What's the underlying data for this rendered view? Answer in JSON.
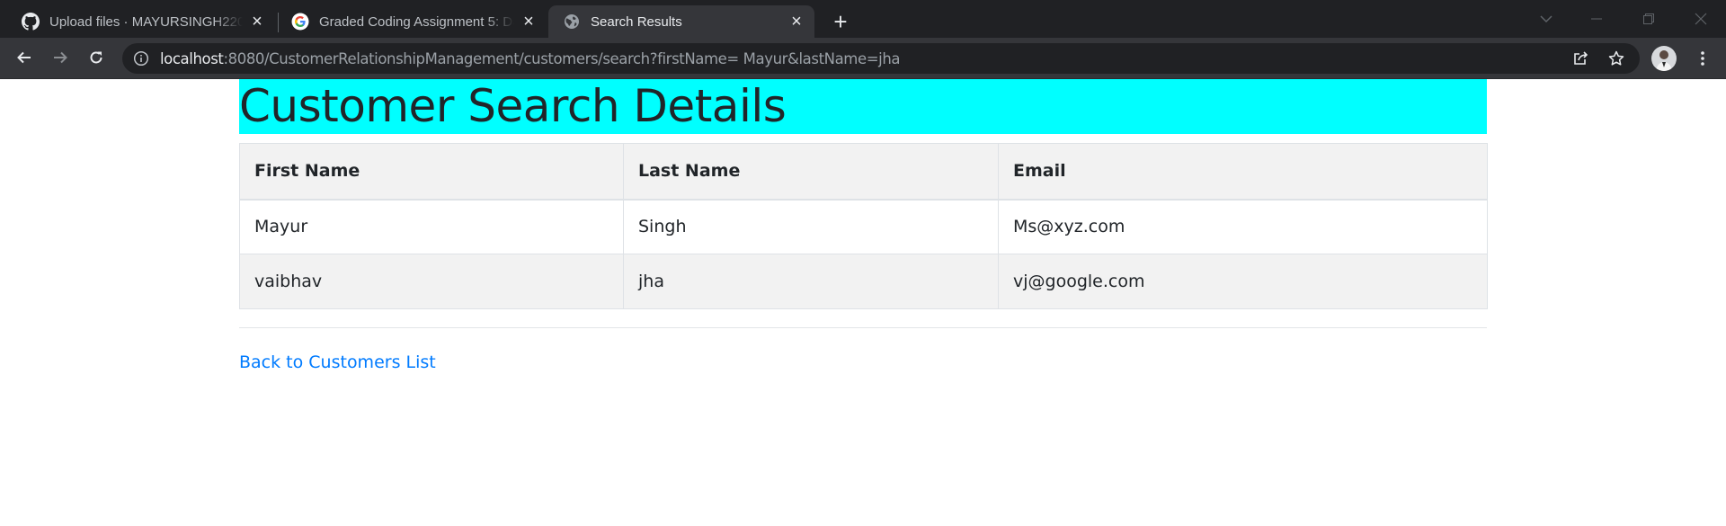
{
  "browser": {
    "tabs": [
      {
        "title": "Upload files · MAYURSINGH2206/",
        "favicon": "github-icon",
        "active": false
      },
      {
        "title": "Graded Coding Assignment 5: Da",
        "favicon": "google-icon",
        "active": false
      },
      {
        "title": "Search Results",
        "favicon": "globe-icon",
        "active": true
      }
    ],
    "new_tab_label": "+",
    "close_tab_glyph": "×",
    "url_host": "localhost",
    "url_rest": ":8080/CustomerRelationshipManagement/customers/search?firstName= Mayur&lastName=jha"
  },
  "page": {
    "heading": "Customer Search Details",
    "heading_bg": "#00ffff",
    "table": {
      "columns": [
        "First Name",
        "Last Name",
        "Email"
      ],
      "rows": [
        [
          "Mayur",
          "Singh",
          "Ms@xyz.com"
        ],
        [
          "vaibhav",
          "jha",
          "vj@google.com"
        ]
      ]
    },
    "back_link": "Back to Customers List",
    "link_color": "#007bff"
  }
}
